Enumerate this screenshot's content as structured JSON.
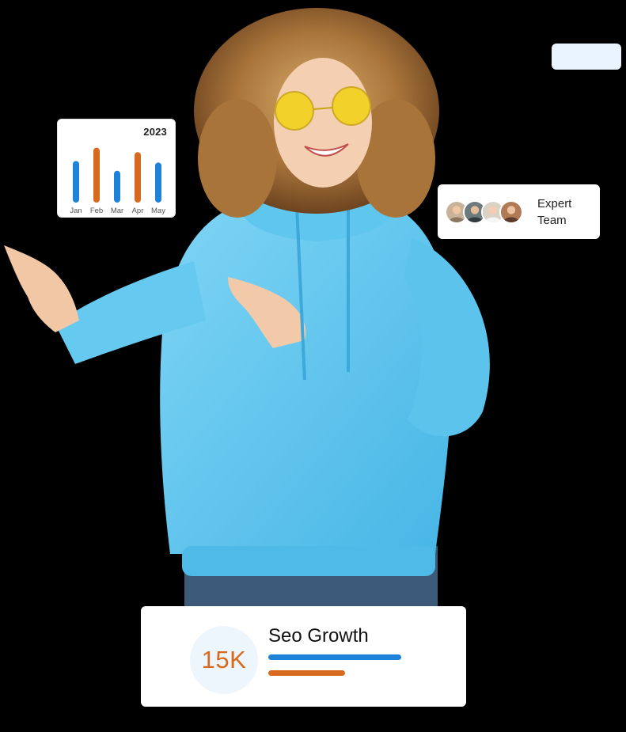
{
  "chart_card": {
    "year": "2023",
    "colors": {
      "blue": "#1e82d8",
      "orange": "#d86a1f"
    }
  },
  "chart_data": {
    "type": "bar",
    "title": "2023",
    "categories": [
      "Jan",
      "Feb",
      "Mar",
      "Apr",
      "May"
    ],
    "values": [
      56,
      74,
      43,
      68,
      54
    ],
    "bar_colors": [
      "#1e82d8",
      "#d86a1f",
      "#1e82d8",
      "#d86a1f",
      "#1e82d8"
    ],
    "ylim": [
      0,
      80
    ],
    "grid": false,
    "axes_visible": false
  },
  "team_card": {
    "label_line1": "Expert",
    "label_line2": "Team",
    "avatar_count": 4
  },
  "seo_card": {
    "value": "15K",
    "title": "Seo Growth",
    "blue_bar_progress": 1.0,
    "orange_bar_progress": 0.58,
    "colors": {
      "blue": "#1e82d8",
      "orange": "#d86a1f",
      "circle": "#eef6fd"
    }
  },
  "person": {
    "hoodie_color": "#6ccdf1",
    "hair_color": "#a8743a",
    "glasses_color": "#f2d21c"
  }
}
